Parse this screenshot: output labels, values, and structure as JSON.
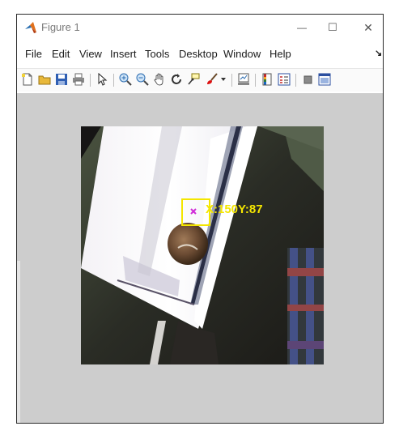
{
  "window": {
    "title": "Figure 1",
    "controls": {
      "minimize": "—",
      "maximize": "☐",
      "close": "✕"
    }
  },
  "menu": {
    "items": [
      "File",
      "Edit",
      "View",
      "Insert",
      "Tools",
      "Desktop",
      "Window",
      "Help"
    ],
    "dock_arrow": "↘"
  },
  "toolbar": {
    "icons": [
      "new-figure-icon",
      "open-file-icon",
      "save-icon",
      "print-icon",
      "select-arrow-icon",
      "zoom-in-icon",
      "zoom-out-icon",
      "pan-hand-icon",
      "rotate-3d-icon",
      "data-cursor-icon",
      "brush-icon",
      "link-plot-icon",
      "colorbar-icon",
      "legend-icon",
      "hide-plot-tools-icon",
      "show-plot-tools-icon"
    ]
  },
  "figure": {
    "tracker": {
      "label": "X:150Y:87",
      "color": "#f4e600",
      "marker_color": "#d02ad8"
    }
  },
  "colors": {
    "figure_background": "#cdcdcd",
    "titlebar": "#ffffff",
    "tracker_box": "#f4e600"
  }
}
